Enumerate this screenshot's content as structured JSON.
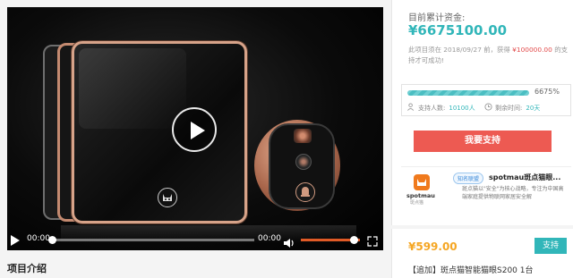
{
  "video": {
    "current_time": "00:00",
    "duration": "00:00",
    "progress": 0,
    "volume": 0.9
  },
  "project_intro": {
    "title": "项目介绍"
  },
  "funding": {
    "raised_label": "目前累计资金:",
    "raised_amount": "¥6675100.00",
    "deadline_prefix": "此项目须在 2018/09/27 前，获得 ",
    "goal_amount": "¥100000.00",
    "deadline_suffix": " 的支持才可成功!",
    "progress_percent": "6675%",
    "progress_fraction": 1.0,
    "supporters_label": "支持人数:",
    "supporters_value": "10100人",
    "time_left_label": "剩余时间:",
    "time_left_value": "20天",
    "support_button": "我要支持"
  },
  "sponsor": {
    "logo_text": "spotmau",
    "logo_sub": "斑点猫",
    "badge": "知名联盟",
    "name": "spotmau斑点猫眼...",
    "description": "斑点猫以\"安全\"为核心战略，专注为中国高端家庭提供物联网家居安全解"
  },
  "reward": {
    "price": "¥599.00",
    "button": "支持",
    "description": "【追加】斑点猫智能猫眼S200 1台"
  },
  "colors": {
    "accent": "#31b6b9",
    "danger": "#ed5a52",
    "price": "#f5a623",
    "volume": "#e05a26"
  },
  "icons": [
    "play-icon",
    "cat-logo-icon",
    "bell-icon",
    "volume-icon",
    "fullscreen-icon",
    "users-icon",
    "clock-icon"
  ]
}
